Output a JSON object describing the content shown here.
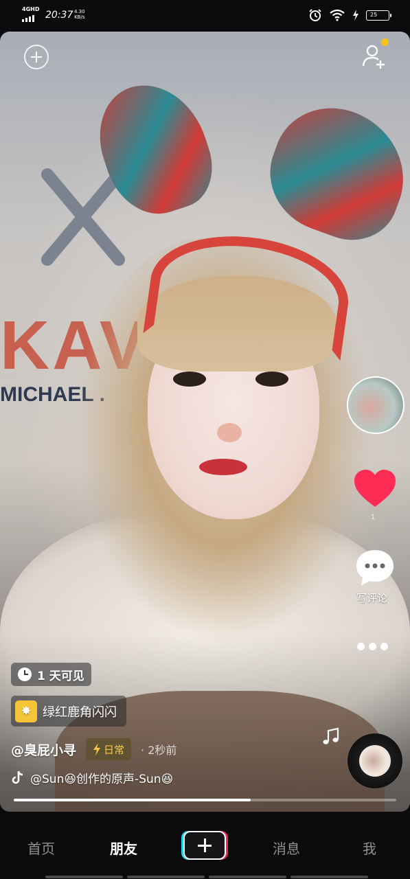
{
  "status_bar": {
    "network": "4GHD",
    "time": "20:37",
    "speed_value": "4.30",
    "speed_unit": "KB/s",
    "battery": "25",
    "signal_strength": 4
  },
  "video": {
    "visibility_label": "1 天可见",
    "effect_name": "绿红鹿角闪闪",
    "author": "@臭屁小寻",
    "tag_label": "日常",
    "time_ago": "· 2秒前",
    "music_text": "@Sun😆创作的原声-Sun😆",
    "like_count": "1",
    "comment_label": "写评论",
    "progress": 0.62,
    "background_texts": [
      "KAV",
      "MICHAEL ."
    ]
  },
  "tabs": [
    {
      "label": "首页",
      "active": false
    },
    {
      "label": "朋友",
      "active": true
    },
    {
      "label": "消息",
      "active": false
    },
    {
      "label": "我",
      "active": false
    }
  ],
  "colors": {
    "like": "#fe2c55",
    "tag_text": "#f6c94a",
    "effect_icon": "#f5c437",
    "notification_dot": "#f6c21b",
    "plus_cyan": "#29d3e3",
    "plus_red": "#f02a55"
  },
  "icons": {
    "add": "plus-circle-icon",
    "friend_add": "person-plus-icon",
    "like": "heart-icon",
    "comment": "speech-bubble-icon",
    "more": "ellipsis-icon",
    "visibility": "clock-icon",
    "effect": "sparkle-icon",
    "tag": "lightning-icon",
    "music": "music-note-icon",
    "tiktok": "tiktok-logo-icon"
  }
}
